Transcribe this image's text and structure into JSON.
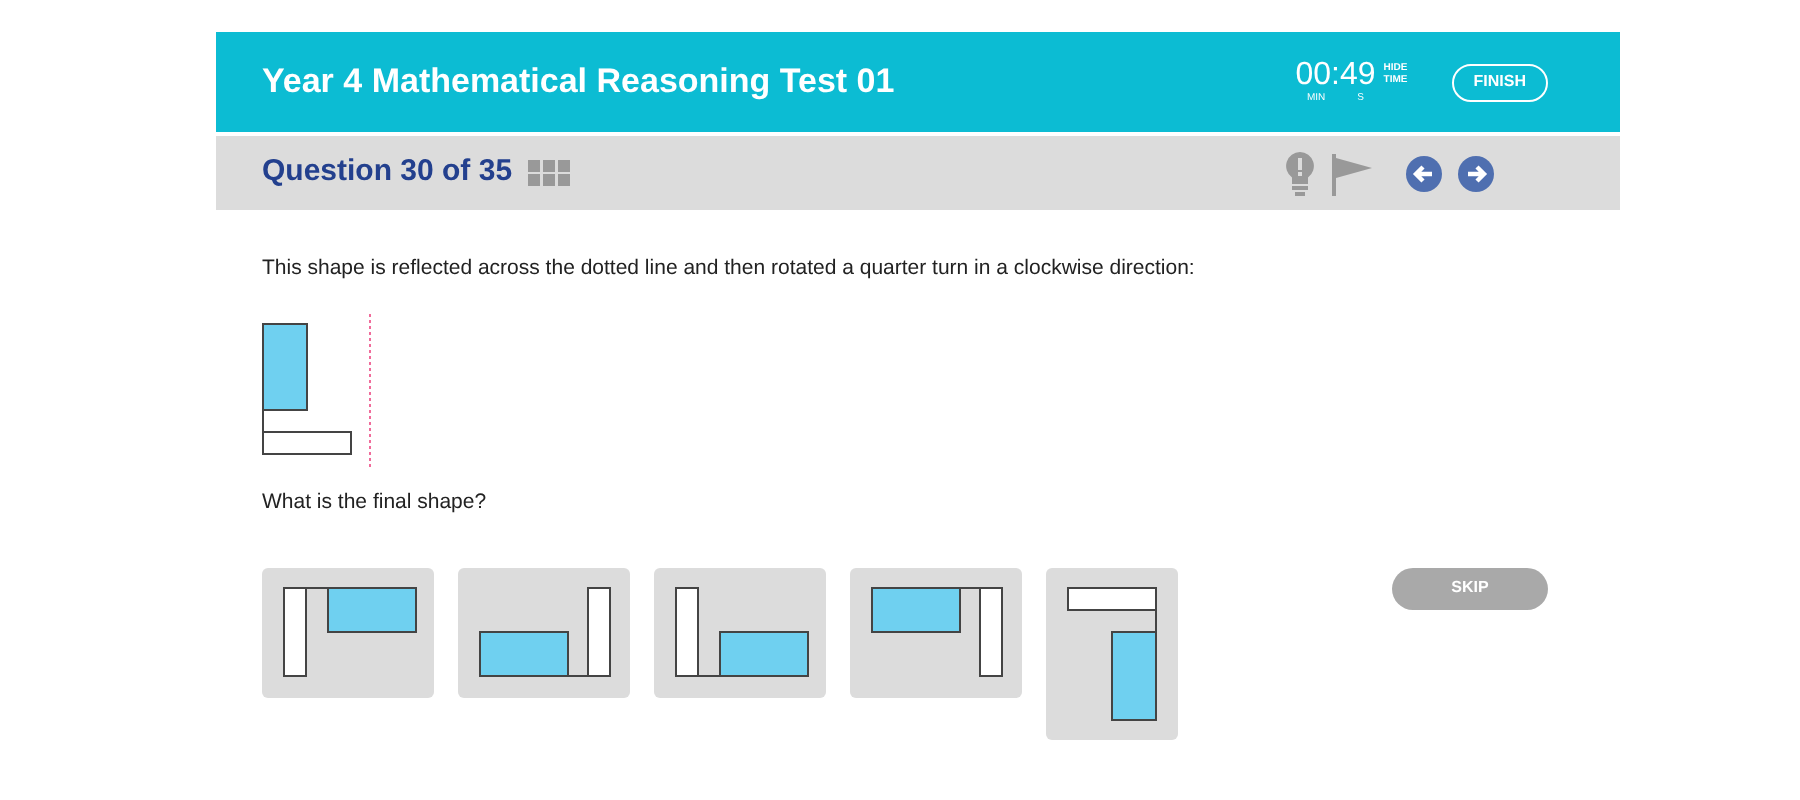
{
  "header": {
    "title": "Year 4 Mathematical Reasoning Test 01",
    "timer": {
      "value": "00:49",
      "min_label": "MIN",
      "sec_label": "S",
      "hide_label": "HIDE TIME"
    },
    "finish_button": "FINISH"
  },
  "question_bar": {
    "label": "Question 30 of 35"
  },
  "question": {
    "prompt": "This shape is reflected across the dotted line and then rotated a quarter turn in a clockwise direction:",
    "sub_prompt": "What is the final shape?"
  },
  "options": [
    {
      "kind": "topright"
    },
    {
      "kind": "bottomleft"
    },
    {
      "kind": "bottomright"
    },
    {
      "kind": "topleft"
    },
    {
      "kind": "vertical"
    }
  ],
  "skip_button": "SKIP"
}
